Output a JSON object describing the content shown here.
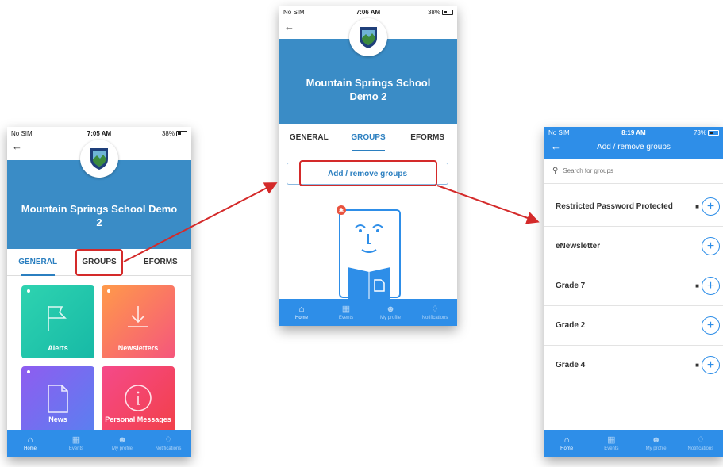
{
  "colors": {
    "banner": "#3a8cc6",
    "nav": "#2e8ee8",
    "accent": "#2b7fc0",
    "highlight": "#d42a2a"
  },
  "phone1": {
    "status": {
      "carrier": "No SIM",
      "time": "7:05 AM",
      "battery": "38%"
    },
    "school_name": "Mountain Springs School Demo 2",
    "tabs": [
      "GENERAL",
      "GROUPS",
      "EFORMS"
    ],
    "tiles": [
      "Alerts",
      "Newsletters",
      "News",
      "Personal Messages"
    ],
    "nav": [
      "Home",
      "Events",
      "My profile",
      "Notifications"
    ]
  },
  "phone2": {
    "status": {
      "carrier": "No SIM",
      "time": "7:06 AM",
      "battery": "38%"
    },
    "school_name": "Mountain Springs School Demo 2",
    "tabs": [
      "GENERAL",
      "GROUPS",
      "EFORMS"
    ],
    "add_remove_button": "Add / remove groups",
    "nav": [
      "Home",
      "Events",
      "My profile",
      "Notifications"
    ]
  },
  "phone3": {
    "status": {
      "carrier": "No SIM",
      "time": "8:19 AM",
      "battery": "73%"
    },
    "title": "Add / remove groups",
    "search_placeholder": "Search for groups",
    "groups": [
      {
        "name": "Restricted Password Protected",
        "locked": true
      },
      {
        "name": "eNewsletter",
        "locked": false
      },
      {
        "name": "Grade 7",
        "locked": true
      },
      {
        "name": "Grade 2",
        "locked": false
      },
      {
        "name": "Grade 4",
        "locked": true
      }
    ],
    "nav": [
      "Home",
      "Events",
      "My profile",
      "Notifications"
    ]
  },
  "icons": {
    "back": "back-arrow-icon",
    "lock": "lock-icon",
    "plus": "plus-circle-icon",
    "search": "search-icon"
  }
}
